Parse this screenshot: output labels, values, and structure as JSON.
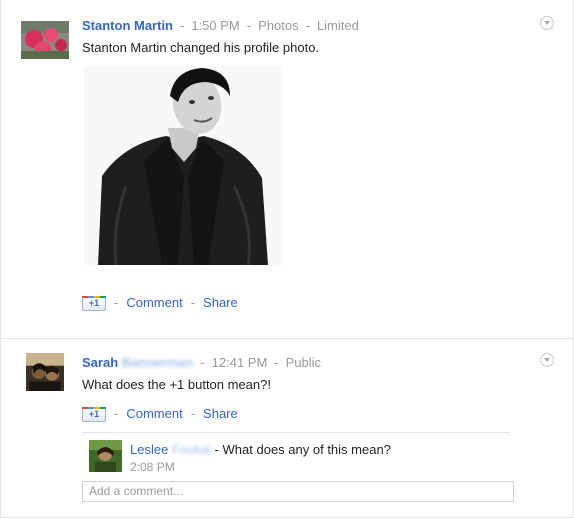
{
  "post1": {
    "author": "Stanton Martin",
    "time": "1:50 PM",
    "category": "Photos",
    "visibility": "Limited",
    "text": "Stanton Martin changed his profile photo.",
    "plusone_label": "+1",
    "comment_label": "Comment",
    "share_label": "Share",
    "separator": "-"
  },
  "post2": {
    "author_first": "Sarah",
    "author_last_blurred": "Bannerman",
    "time": "12:41 PM",
    "visibility": "Public",
    "text": "What does the +1 button mean?!",
    "plusone_label": "+1",
    "comment_label": "Comment",
    "share_label": "Share",
    "separator": "-"
  },
  "comment": {
    "author_first": "Leslee",
    "author_last_blurred": "Foukal",
    "text": "- What does any of this mean?",
    "time": "2:08 PM"
  },
  "composer": {
    "placeholder": "Add a comment..."
  },
  "colors": {
    "link": "#3366cc",
    "muted": "#999999",
    "divider": "#e5e5e5"
  }
}
